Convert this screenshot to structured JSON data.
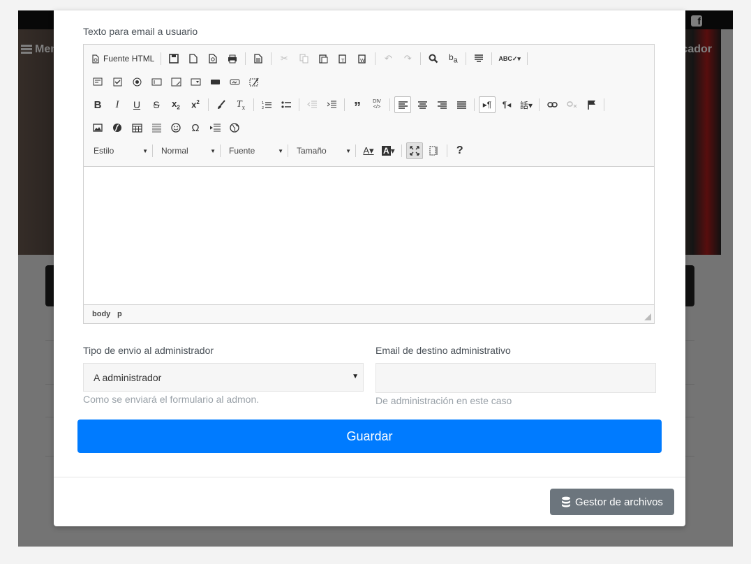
{
  "background": {
    "menu_label": "Men",
    "right_label": "cador"
  },
  "form": {
    "email_text_label": "Texto para email a usuario",
    "admin_send_type_label": "Tipo de envio al administrador",
    "admin_send_type_value": "A administrador",
    "admin_send_type_help": "Como se enviará el formulario al admon.",
    "admin_email_label": "Email de destino administrativo",
    "admin_email_value": "",
    "admin_email_help": "De administración en este caso",
    "save_label": "Guardar"
  },
  "editor": {
    "source_label": "Fuente HTML",
    "combos": {
      "style": "Estilo",
      "format": "Normal",
      "font": "Fuente",
      "size": "Tamaño"
    },
    "path": [
      "body",
      "p"
    ]
  },
  "footer": {
    "file_manager_label": "Gestor de archivos"
  }
}
